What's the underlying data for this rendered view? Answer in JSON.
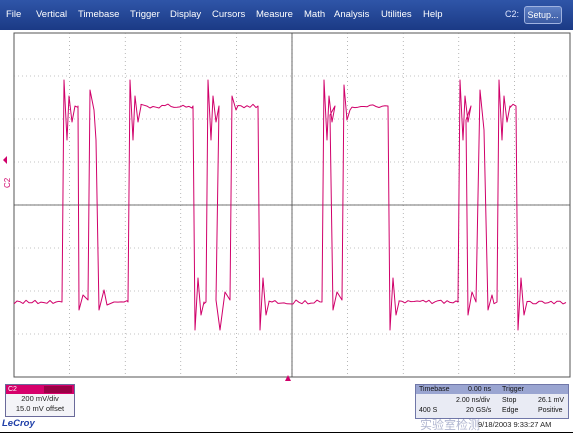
{
  "menu": {
    "items": [
      "File",
      "Vertical",
      "Timebase",
      "Trigger",
      "Display",
      "Cursors",
      "Measure",
      "Math",
      "Analysis",
      "Utilities",
      "Help"
    ],
    "channel_indicator": "C2:",
    "setup_label": "Setup..."
  },
  "trace": {
    "label": "C2",
    "color": "#d0006a",
    "grid_divisions": {
      "horizontal": 10,
      "vertical": 8
    },
    "trigger_marker_color": "#d0006a"
  },
  "channel_box": {
    "name": "C2",
    "vdiv": "200 mV/div",
    "offset": "15.0 mV offset"
  },
  "timebase_box": {
    "timebase_label": "Timebase",
    "timebase_value": "0.00 ns",
    "trigger_label": "Trigger",
    "time_per_div": "2.00 ns/div",
    "mode": "Stop",
    "trigger_level": "26.1 mV",
    "samples": "400 S",
    "sample_rate": "20 GS/s",
    "trigger_type": "Edge",
    "slope": "Positive"
  },
  "footer": {
    "brand": "LeCroy",
    "timestamp": "9/18/2003 9:33:27 AM",
    "watermark": "实验室检测"
  }
}
